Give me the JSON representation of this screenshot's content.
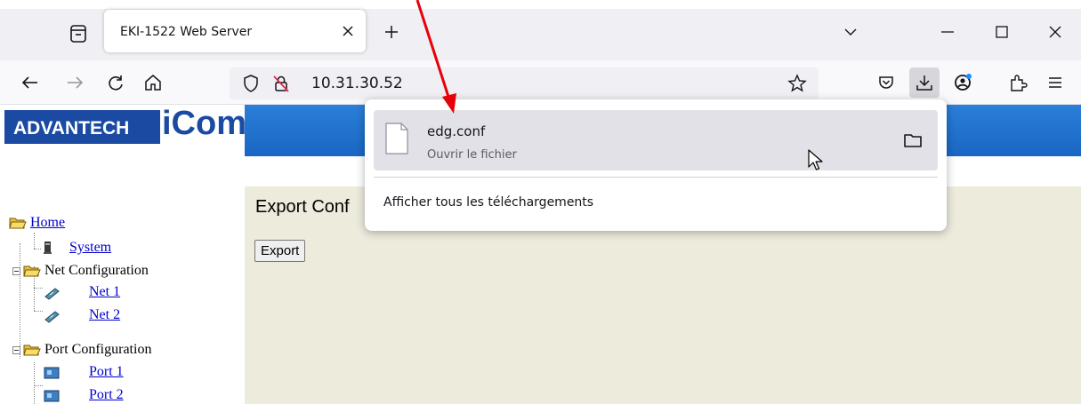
{
  "browser": {
    "tab": {
      "title": "EKI-1522 Web Server"
    },
    "url": "10.31.30.52"
  },
  "page": {
    "logo": {
      "brand": "ADVANTECH",
      "product": "iCom"
    },
    "content": {
      "title": "Export Conf",
      "export_button": "Export"
    },
    "tree": {
      "home": "Home",
      "system": "System",
      "net_config": "Net Configuration",
      "net1": "Net 1",
      "net2": "Net 2",
      "port_config": "Port Configuration",
      "port1": "Port 1",
      "port2": "Port 2"
    }
  },
  "downloads_panel": {
    "item": {
      "filename": "edg.conf",
      "status": "Ouvrir le fichier"
    },
    "show_all_label": "Afficher tous les téléchargements"
  },
  "colors": {
    "annotation_arrow": "#e8000b",
    "link": "#0000cc",
    "content_bg": "#ecebdc",
    "banner_blue": "#1a66c4"
  }
}
